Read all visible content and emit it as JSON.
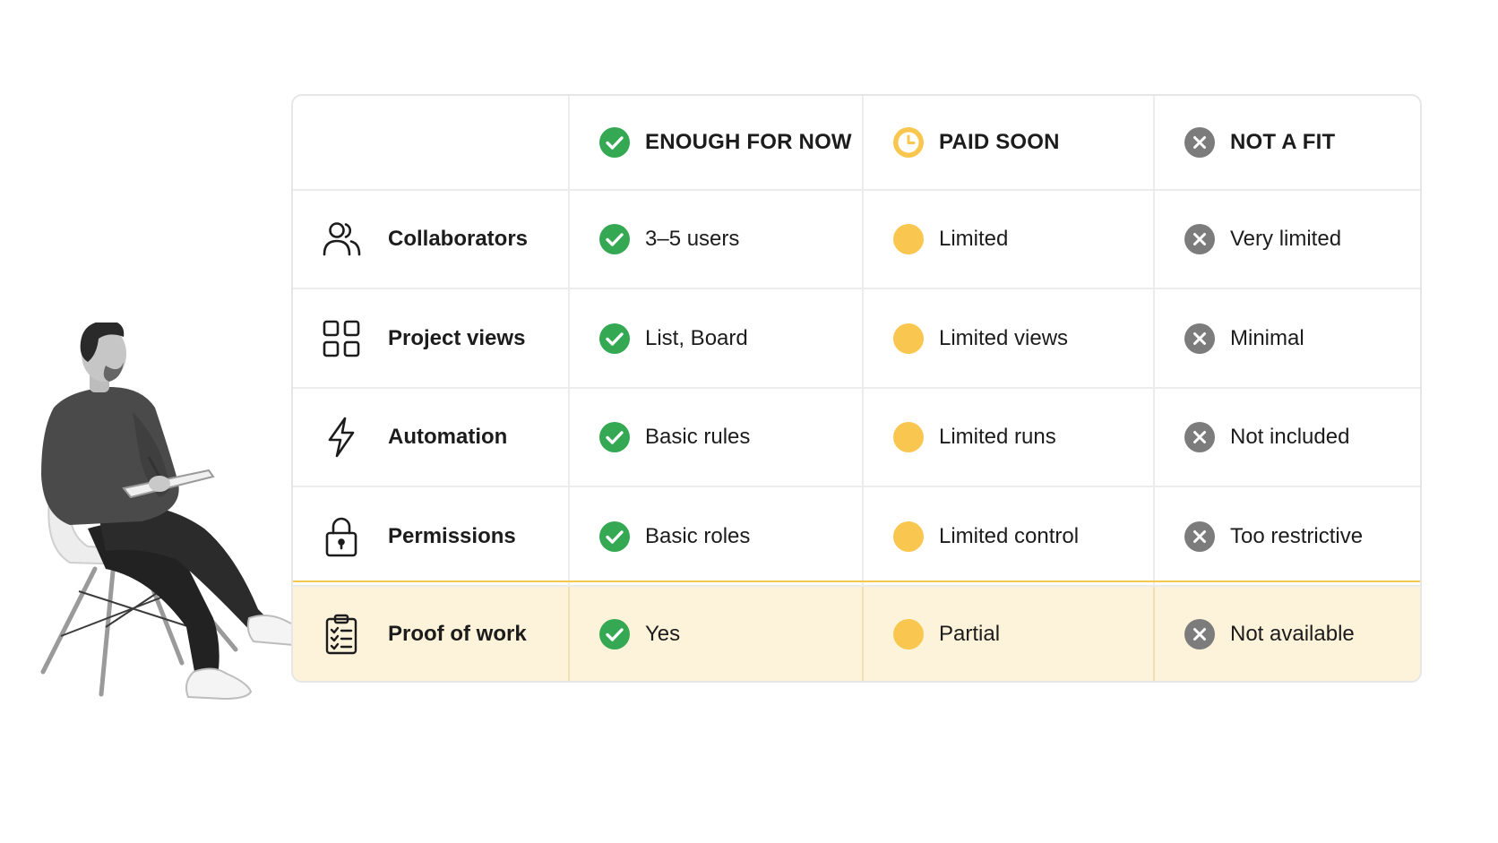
{
  "colors": {
    "check_green": "#34a853",
    "partial_yellow": "#f9c74f",
    "cross_gray": "#7c7c7c",
    "highlight_bg": "#fdf2da",
    "highlight_border": "#f2c94c"
  },
  "header": {
    "columns": [
      {
        "label": "ENOUGH FOR NOW",
        "icon": "check-circle-icon"
      },
      {
        "label": "PAID SOON",
        "icon": "clock-icon"
      },
      {
        "label": "NOT A FIT",
        "icon": "x-circle-icon"
      }
    ]
  },
  "rows": [
    {
      "feature": "Collaborators",
      "icon": "users-icon",
      "values": [
        "3–5 users",
        "Limited",
        "Very limited"
      ]
    },
    {
      "feature": "Project views",
      "icon": "grid-icon",
      "values": [
        "List, Board",
        "Limited views",
        "Minimal"
      ]
    },
    {
      "feature": "Automation",
      "icon": "lightning-icon",
      "values": [
        "Basic rules",
        "Limited runs",
        "Not included"
      ]
    },
    {
      "feature": "Permissions",
      "icon": "lock-icon",
      "values": [
        "Basic roles",
        "Limited control",
        "Too restrictive"
      ]
    },
    {
      "feature": "Proof of work",
      "icon": "clipboard-checklist-icon",
      "values": [
        "Yes",
        "Partial",
        "Not available"
      ],
      "highlighted": true
    }
  ],
  "illustration": "person-sitting-on-chair-with-notebook"
}
